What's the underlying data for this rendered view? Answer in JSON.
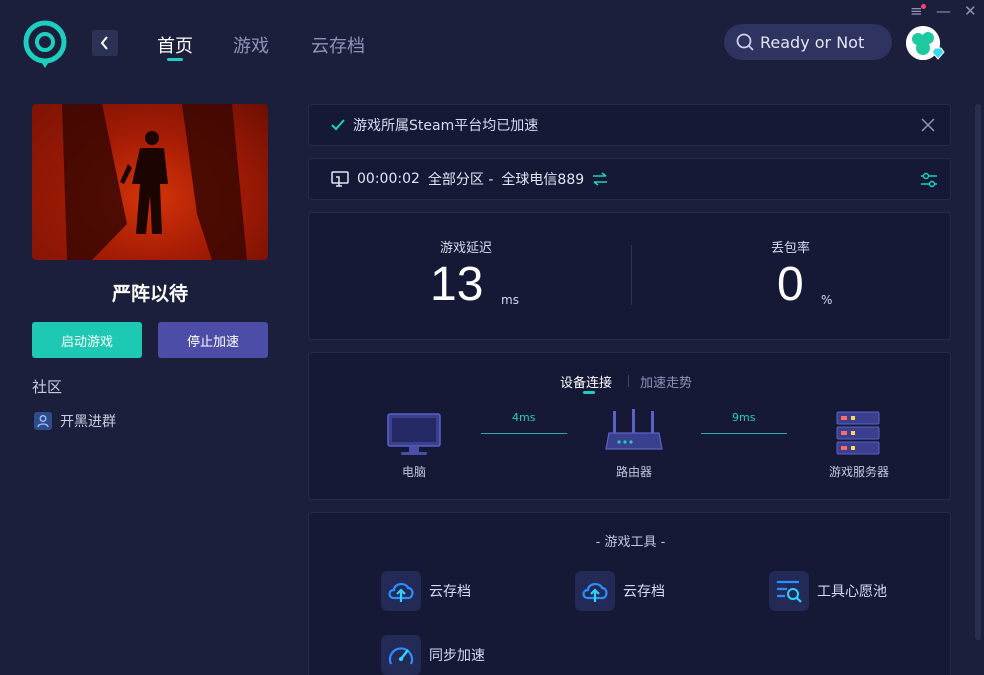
{
  "nav": {
    "tabs": [
      {
        "label": "首页",
        "active": true
      },
      {
        "label": "游戏",
        "active": false
      },
      {
        "label": "云存档",
        "active": false
      }
    ],
    "back_icon": "chevron-left-icon"
  },
  "search": {
    "value": "Ready or Not",
    "icon": "search-icon"
  },
  "window_controls": {
    "menu": "≡",
    "minimize": "—",
    "close": "✕"
  },
  "colors": {
    "accent": "#1ecfc0",
    "start_button": "#1ec9b4",
    "stop_button": "#4b4da6",
    "background": "#1b1f3b"
  },
  "game": {
    "title": "严阵以待",
    "start_button": "启动游戏",
    "stop_button": "停止加速"
  },
  "community": {
    "heading": "社区",
    "items": [
      {
        "label": "开黑进群",
        "icon": "user-group-icon"
      }
    ]
  },
  "notice": {
    "text": "游戏所属Steam平台均已加速",
    "icon": "check-icon"
  },
  "route": {
    "elapsed": "00:00:02",
    "region": "全部分区 -",
    "node": "全球电信889",
    "icon": "monitor-icon",
    "switch_icon": "switch-arrows-icon",
    "settings_icon": "sliders-icon"
  },
  "stats": {
    "latency": {
      "label": "游戏延迟",
      "value": "13",
      "unit": "ms"
    },
    "packet_loss": {
      "label": "丢包率",
      "value": "0",
      "unit": "%"
    }
  },
  "device": {
    "tabs": [
      {
        "label": "设备连接",
        "active": true
      },
      {
        "label": "加速走势",
        "active": false
      }
    ],
    "nodes": [
      {
        "label": "电脑",
        "icon": "computer-icon"
      },
      {
        "label": "路由器",
        "icon": "router-icon"
      },
      {
        "label": "游戏服务器",
        "icon": "server-icon"
      }
    ],
    "links": [
      {
        "latency": "4ms"
      },
      {
        "latency": "9ms"
      }
    ]
  },
  "tools": {
    "title": "- 游戏工具 -",
    "items": [
      {
        "label": "云存档",
        "icon": "cloud-upload-icon"
      },
      {
        "label": "云存档",
        "icon": "cloud-upload-icon"
      },
      {
        "label": "工具心愿池",
        "icon": "search-list-icon"
      },
      {
        "label": "同步加速",
        "icon": "gauge-icon"
      }
    ]
  }
}
